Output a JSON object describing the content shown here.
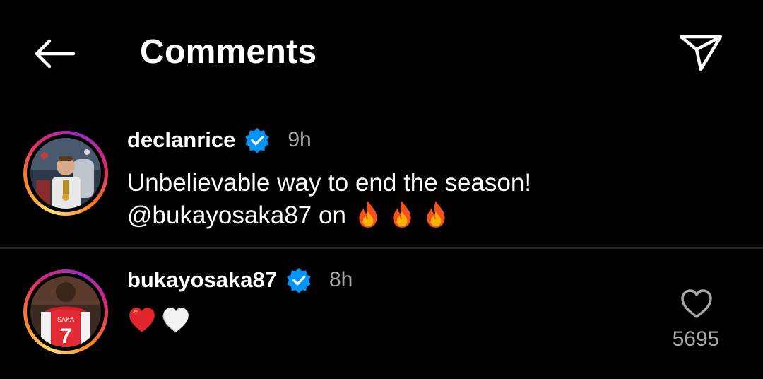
{
  "header": {
    "title": "Comments",
    "back_icon": "arrow-left-icon",
    "share_icon": "send-icon"
  },
  "comments": [
    {
      "username": "declanrice",
      "verified": true,
      "time": "9h",
      "text_line1": "Unbelievable way to end the season!",
      "text_line2": "@bukayosaka87 on",
      "emojis": [
        "fire-emoji",
        "fire-emoji",
        "fire-emoji"
      ]
    },
    {
      "username": "bukayosaka87",
      "verified": true,
      "time": "8h",
      "emojis": [
        "red-heart-emoji",
        "white-heart-emoji"
      ],
      "likes": "5695"
    }
  ],
  "colors": {
    "background": "#000000",
    "text": "#ffffff",
    "secondary_text": "#a8a8a8",
    "verified_blue": "#0095f6",
    "divider": "#262626"
  }
}
